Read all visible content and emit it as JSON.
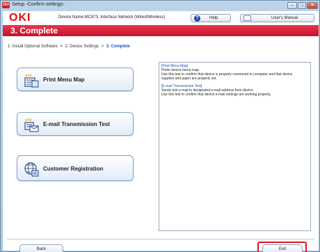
{
  "window": {
    "title": "Setup -Confirm settings-",
    "app_icon_text": "OKI"
  },
  "header": {
    "logo": "OKI",
    "device_name": "Device Name:MC873, Interface Network (Wired/Wireless)",
    "help_label": "Help",
    "manual_label": "User's Manual"
  },
  "banner": {
    "title": "3. Complete"
  },
  "breadcrumb": {
    "step1": "1. Install Optional Software",
    "sep": ">",
    "step2": "2. Device Settings",
    "current": "3. Complete"
  },
  "actions": [
    {
      "label": "Print Menu Map",
      "icon": "printer-map-icon"
    },
    {
      "label": "E-mail Transmission Test",
      "icon": "email-test-icon"
    },
    {
      "label": "Customer Registration",
      "icon": "globe-registration-icon"
    }
  ],
  "info": {
    "sections": [
      {
        "heading": "[Print Menu Map]",
        "lines": [
          "Prints device menu map.",
          "Use this test to confirm that device is properly connected to computer and that device",
          "supplies and paper are properly set."
        ]
      },
      {
        "heading": "[E-mail Transmission Test]",
        "lines": [
          "Sends test e-mail to designated e-mail address from device.",
          "Use this test to confirm that device e-mail settings are working properly."
        ]
      }
    ]
  },
  "footer": {
    "back_label": "Back",
    "exit_label": "Exit"
  },
  "colors": {
    "brand_red": "#e20a16",
    "banner_red": "#d91e36",
    "highlight": "#e0141e",
    "link_blue": "#1a4fb8"
  }
}
